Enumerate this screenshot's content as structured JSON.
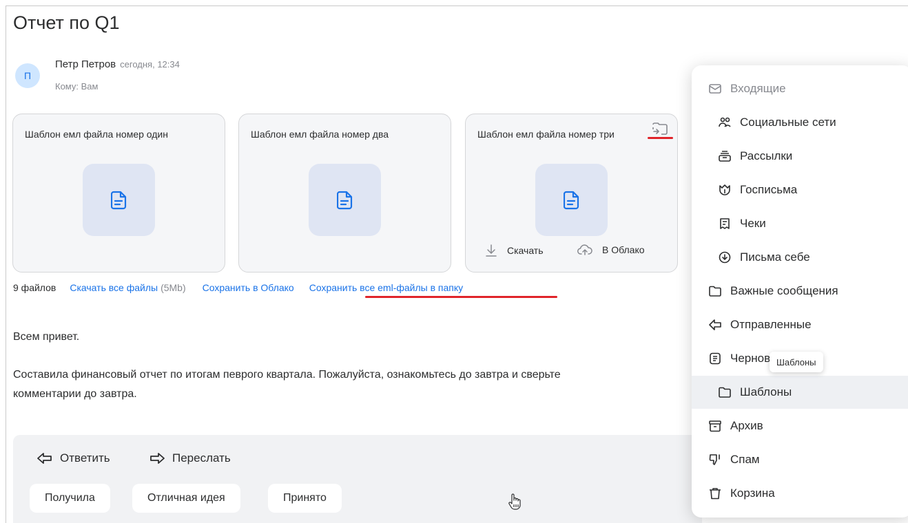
{
  "email": {
    "subject": "Отчет по Q1",
    "sender": {
      "initial": "П",
      "name": "Петр Петров",
      "time": "сегодня, 12:34",
      "to": "Кому: Вам"
    },
    "attachments": [
      {
        "name": "Шаблон емл файла номер один"
      },
      {
        "name": "Шаблон емл файла номер два"
      },
      {
        "name": "Шаблон емл файла номер три",
        "download_label": "Скачать",
        "cloud_label": "В Облако"
      }
    ],
    "files_bar": {
      "count": "9 файлов",
      "download_all": "Скачать все файлы",
      "size": "(5Mb)",
      "save_cloud": "Сохранить в Облако",
      "save_eml": "Сохранить все eml-файлы в папку"
    },
    "body": {
      "greeting": "Всем привет.",
      "paragraph": "Составила финансовый отчет по итогам певрого квартала. Пожалуйста, ознакомьтесь до завтра и сверьте",
      "paragraph2": "комментарии до завтра."
    },
    "actions": {
      "reply": "Ответить",
      "forward": "Переслать"
    },
    "quick_replies": [
      "Получила",
      "Отличная идея",
      "Принято"
    ]
  },
  "folder_menu": {
    "items": [
      {
        "label": "Входящие",
        "icon": "mail-icon"
      },
      {
        "label": "Социальные сети",
        "icon": "people-icon"
      },
      {
        "label": "Рассылки",
        "icon": "newsletter-icon"
      },
      {
        "label": "Госписьма",
        "icon": "emblem-icon"
      },
      {
        "label": "Чеки",
        "icon": "receipt-icon"
      },
      {
        "label": "Письма себе",
        "icon": "self-mail-icon"
      },
      {
        "label": "Важные сообщения",
        "icon": "folder-icon"
      },
      {
        "label": "Отправленные",
        "icon": "sent-icon"
      },
      {
        "label": "Черновики",
        "icon": "draft-icon"
      },
      {
        "label": "Шаблоны",
        "icon": "folder-icon"
      },
      {
        "label": "Архив",
        "icon": "archive-icon"
      },
      {
        "label": "Спам",
        "icon": "spam-icon"
      },
      {
        "label": "Корзина",
        "icon": "trash-icon"
      }
    ],
    "tooltip": "Шаблоны",
    "highlighted": "Шаблоны"
  },
  "colors": {
    "link": "#1a73e8",
    "accent_underline": "#e0242a",
    "avatar_bg": "#cfe6ff",
    "thumb_bg": "#dfe5f3"
  }
}
